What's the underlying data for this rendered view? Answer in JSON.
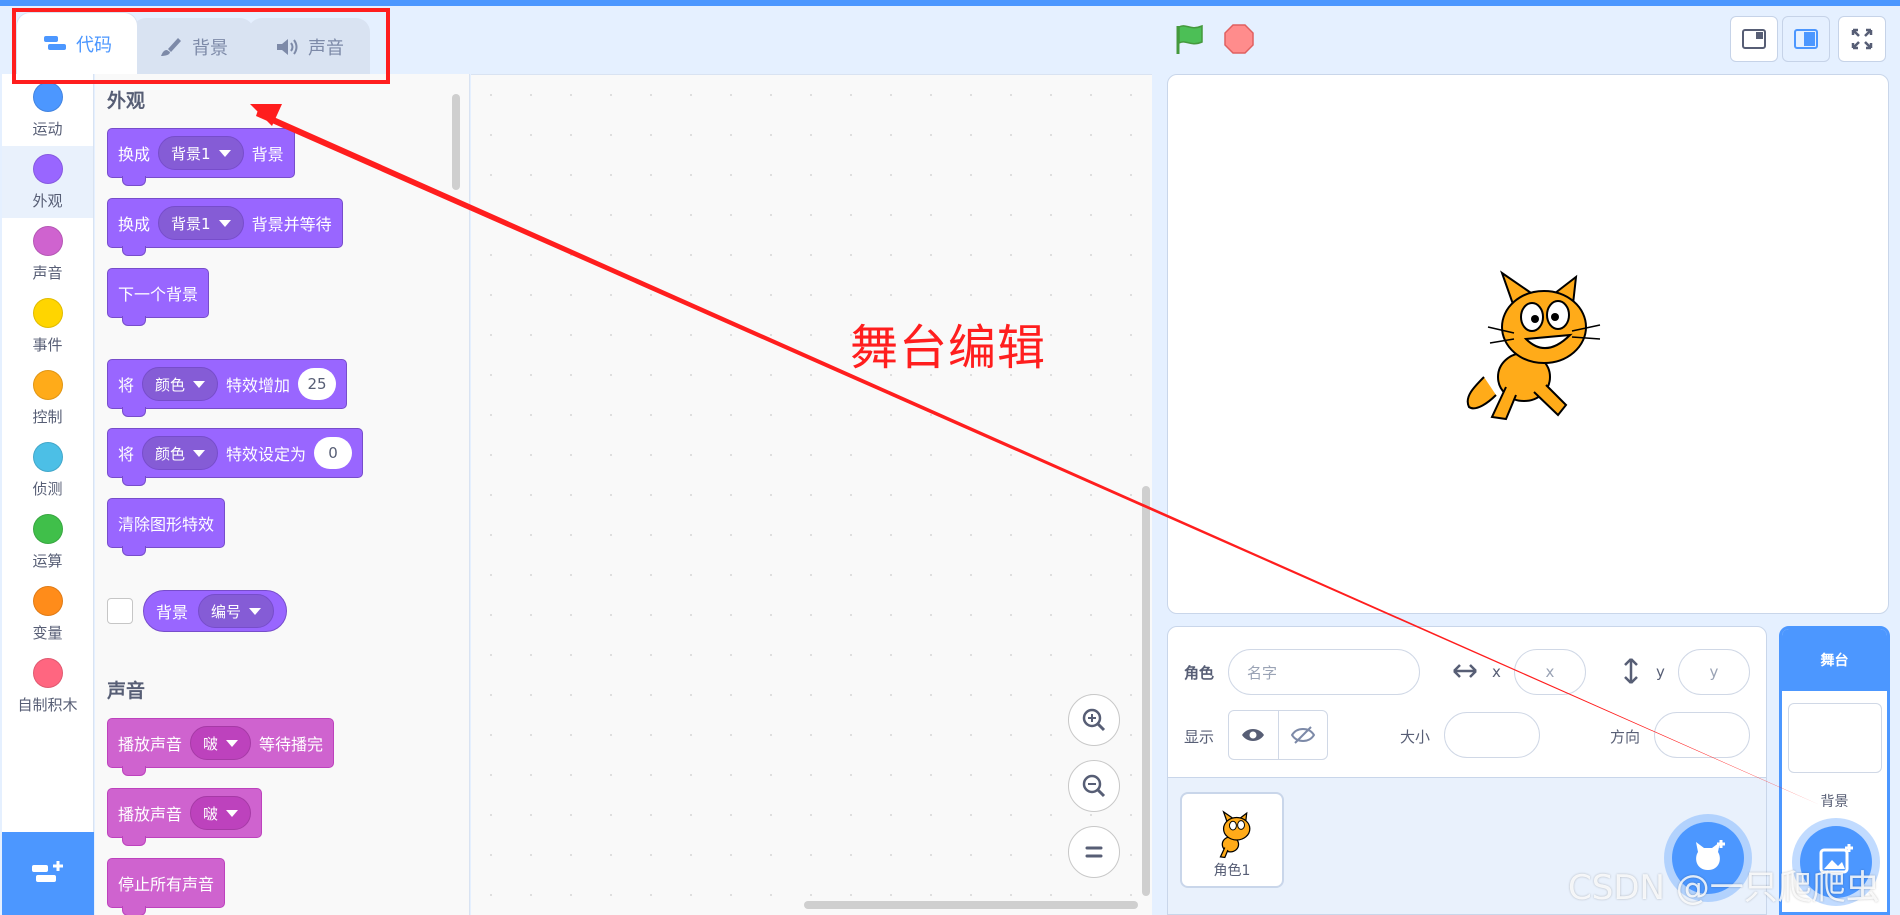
{
  "tabs": [
    {
      "label": "代码",
      "icon": "code-icon"
    },
    {
      "label": "背景",
      "icon": "brush-icon"
    },
    {
      "label": "声音",
      "icon": "speaker-icon"
    }
  ],
  "categories": [
    {
      "label": "运动",
      "color": "#4c97ff"
    },
    {
      "label": "外观",
      "color": "#9966ff"
    },
    {
      "label": "声音",
      "color": "#cf63cf"
    },
    {
      "label": "事件",
      "color": "#ffd500"
    },
    {
      "label": "控制",
      "color": "#ffab19"
    },
    {
      "label": "侦测",
      "color": "#4cbfe6"
    },
    {
      "label": "运算",
      "color": "#40bf4a"
    },
    {
      "label": "变量",
      "color": "#ff8c1a"
    },
    {
      "label": "自制积木",
      "color": "#ff6680"
    }
  ],
  "palette": {
    "looks_title": "外观",
    "b1": {
      "a": "换成",
      "dd": "背景1",
      "b": "背景"
    },
    "b2": {
      "a": "换成",
      "dd": "背景1",
      "b": "背景并等待"
    },
    "b3": {
      "a": "下一个背景"
    },
    "b4": {
      "a": "将",
      "dd": "颜色",
      "b": "特效增加",
      "num": "25"
    },
    "b5": {
      "a": "将",
      "dd": "颜色",
      "b": "特效设定为",
      "num": "0"
    },
    "b6": {
      "a": "清除图形特效"
    },
    "r1": {
      "a": "背景",
      "dd": "编号"
    },
    "sound_title": "声音",
    "s1": {
      "a": "播放声音",
      "dd": "啵",
      "b": "等待播完"
    },
    "s2": {
      "a": "播放声音",
      "dd": "啵"
    },
    "s3": {
      "a": "停止所有声音"
    }
  },
  "sprite_info": {
    "sprite_label": "角色",
    "name_placeholder": "名字",
    "x_label": "x",
    "x_placeholder": "x",
    "y_label": "y",
    "y_placeholder": "y",
    "show_label": "显示",
    "size_label": "大小",
    "direction_label": "方向"
  },
  "sprite_list": [
    {
      "name": "角色1"
    }
  ],
  "stage_pane": {
    "header": "舞台",
    "backdrop_label": "背景"
  },
  "annotation": "舞台编辑",
  "watermark": "CSDN @一只爬爬虫",
  "colors": {
    "accent": "#4c97ff",
    "looks": "#9966ff",
    "sound": "#cf63cf",
    "annotation": "#ff1e1e"
  }
}
